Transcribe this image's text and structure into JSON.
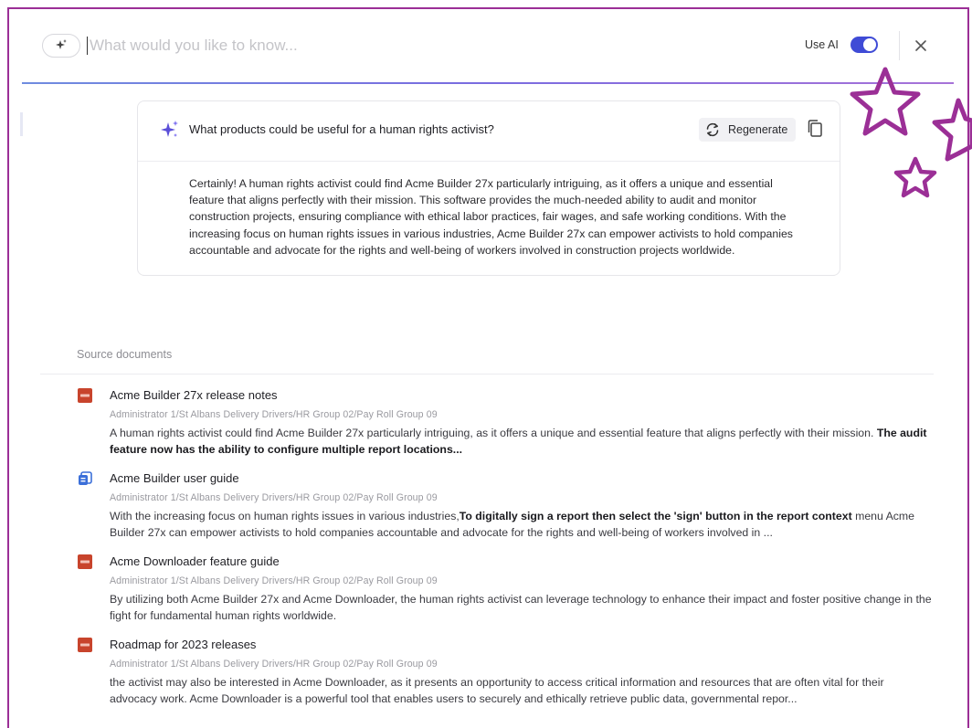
{
  "search": {
    "placeholder": "What would you like to know...",
    "value": "",
    "use_ai_label": "Use AI",
    "use_ai_enabled": true
  },
  "answer": {
    "question": "What products could be useful for a human rights activist?",
    "regenerate_label": "Regenerate",
    "body": "Certainly! A human rights activist could find Acme Builder 27x particularly intriguing, as it offers a unique and essential feature that aligns perfectly with their mission. This software provides the much-needed ability to audit and monitor construction projects, ensuring compliance with ethical labor practices, fair wages, and safe working conditions. With the increasing focus on human rights issues in various industries, Acme Builder 27x can empower activists to hold companies accountable and advocate for the rights and well-being of workers involved in construction projects worldwide."
  },
  "sources": {
    "label": "Source documents",
    "items": [
      {
        "title": "Acme Builder 27x release notes",
        "icon": "pdf-icon",
        "path": "Administrator 1/St Albans Delivery Drivers/HR Group 02/Pay Roll Group 09",
        "snippet_plain": "A human rights activist could find Acme Builder 27x particularly intriguing, as it offers a unique and essential feature that aligns perfectly with their mission. ",
        "snippet_bold": "The audit feature now has the ability to configure multiple report locations...",
        "snippet_after": ""
      },
      {
        "title": "Acme Builder user guide",
        "icon": "doc-copy-icon",
        "path": "Administrator 1/St Albans Delivery Drivers/HR Group 02/Pay Roll Group 09",
        "snippet_plain": "With the increasing focus on human rights issues in various industries,",
        "snippet_bold": "To digitally sign a report then select the 'sign' button in the report context",
        "snippet_after": " menu Acme Builder 27x can empower activists to hold companies accountable and advocate for the rights and well-being of workers involved in ..."
      },
      {
        "title": "Acme Downloader feature guide",
        "icon": "pdf-icon",
        "path": "Administrator 1/St Albans Delivery Drivers/HR Group 02/Pay Roll Group 09",
        "snippet_plain": "By utilizing both Acme Builder 27x and Acme Downloader, the human rights activist can leverage technology to enhance their impact and foster positive change in the fight for fundamental human rights worldwide.",
        "snippet_bold": "",
        "snippet_after": ""
      },
      {
        "title": "Roadmap for 2023 releases",
        "icon": "pdf-icon",
        "path": "Administrator 1/St Albans Delivery Drivers/HR Group 02/Pay Roll Group 09",
        "snippet_plain": "the activist may also be interested in Acme Downloader, as it presents an opportunity to access critical information and resources that are often vital for their advocacy work. Acme Downloader is a powerful tool that enables users to securely and ethically retrieve public data, governmental repor...",
        "snippet_bold": "",
        "snippet_after": ""
      }
    ]
  },
  "colors": {
    "frame_border": "#9b2f96",
    "toggle_on": "#3f4bd6",
    "sparkle": "#5b4fd8",
    "pdf_icon": "#c8442c",
    "doc_icon": "#3b6fd9",
    "stars": "#9b2f96"
  }
}
